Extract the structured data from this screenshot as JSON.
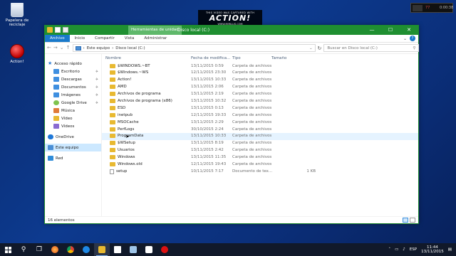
{
  "desktop": {
    "recycle_bin_label": "Papelera de reciclaje",
    "action_label": "Action!"
  },
  "watermark": {
    "top_line": "THIS VIDEO WAS CAPTURED WITH",
    "logo": "ACTION!",
    "url": "WWW.MIRILLIS.COM"
  },
  "rec_badge": {
    "fps": "77",
    "timer": "0:00:38"
  },
  "window": {
    "title": "Disco local (C:)",
    "context_tab": "Herramientas de unidad",
    "controls": {
      "minimize": "—",
      "maximize": "☐",
      "close": "✕"
    }
  },
  "ribbon": {
    "tabs": [
      "Archivo",
      "Inicio",
      "Compartir",
      "Vista",
      "Administrar"
    ]
  },
  "address": {
    "back": "←",
    "forward": "→",
    "up": "↑",
    "path_root": "Este equipo",
    "path_sep": "›",
    "path_current": "Disco local (C:)",
    "search_placeholder": "Buscar en Disco local (C:)"
  },
  "nav_pane": {
    "quick_access": "Acceso rápido",
    "quick_items": [
      {
        "label": "Escritorio",
        "pinned": true
      },
      {
        "label": "Descargas",
        "pinned": true
      },
      {
        "label": "Documentos",
        "pinned": true
      },
      {
        "label": "Imágenes",
        "pinned": true
      },
      {
        "label": "Google Drive",
        "pinned": true
      },
      {
        "label": "Música",
        "pinned": false
      },
      {
        "label": "Vídeo",
        "pinned": false
      },
      {
        "label": "Vídeos",
        "pinned": false
      }
    ],
    "onedrive": "OneDrive",
    "this_pc": "Este equipo",
    "network": "Red"
  },
  "columns": {
    "name": "Nombre",
    "date": "Fecha de modifica...",
    "type": "Tipo",
    "size": "Tamaño"
  },
  "files": [
    {
      "name": "$WINDOWS.~BT",
      "date": "13/11/2015 0:59",
      "type": "Carpeta de archivos",
      "size": "",
      "kind": "folder"
    },
    {
      "name": "$Windows.~WS",
      "date": "12/11/2015 23:30",
      "type": "Carpeta de archivos",
      "size": "",
      "kind": "folder"
    },
    {
      "name": "Action!",
      "date": "13/11/2015 10:33",
      "type": "Carpeta de archivos",
      "size": "",
      "kind": "folder"
    },
    {
      "name": "AMD",
      "date": "13/11/2015 2:06",
      "type": "Carpeta de archivos",
      "size": "",
      "kind": "folder"
    },
    {
      "name": "Archivos de programa",
      "date": "13/11/2015 2:19",
      "type": "Carpeta de archivos",
      "size": "",
      "kind": "folder"
    },
    {
      "name": "Archivos de programa (x86)",
      "date": "13/11/2015 10:32",
      "type": "Carpeta de archivos",
      "size": "",
      "kind": "folder"
    },
    {
      "name": "ESD",
      "date": "13/11/2015 0:13",
      "type": "Carpeta de archivos",
      "size": "",
      "kind": "folder"
    },
    {
      "name": "inetpub",
      "date": "12/11/2015 19:33",
      "type": "Carpeta de archivos",
      "size": "",
      "kind": "folder"
    },
    {
      "name": "MSOCache",
      "date": "13/11/2015 2:29",
      "type": "Carpeta de archivos",
      "size": "",
      "kind": "folder"
    },
    {
      "name": "PerfLogs",
      "date": "30/10/2015 2:24",
      "type": "Carpeta de archivos",
      "size": "",
      "kind": "folder"
    },
    {
      "name": "ProgramData",
      "date": "13/11/2015 10:33",
      "type": "Carpeta de archivos",
      "size": "",
      "kind": "folder",
      "hover": true
    },
    {
      "name": "$WSetup",
      "date": "13/11/2015 8:19",
      "type": "Carpeta de archivos",
      "size": "",
      "kind": "folder"
    },
    {
      "name": "Usuarios",
      "date": "13/11/2015 2:42",
      "type": "Carpeta de archivos",
      "size": "",
      "kind": "folder"
    },
    {
      "name": "Windows",
      "date": "13/11/2015 11:35",
      "type": "Carpeta de archivos",
      "size": "",
      "kind": "folder"
    },
    {
      "name": "Windows.old",
      "date": "12/11/2015 19:43",
      "type": "Carpeta de archivos",
      "size": "",
      "kind": "folder"
    },
    {
      "name": "setup",
      "date": "10/11/2015 7:17",
      "type": "Documento de tex...",
      "size": "1 KB",
      "kind": "file"
    }
  ],
  "status": {
    "count": "16 elementos"
  },
  "taskbar": {
    "tray_lang": "ESP",
    "time": "11:44",
    "date": "13/11/2015"
  }
}
